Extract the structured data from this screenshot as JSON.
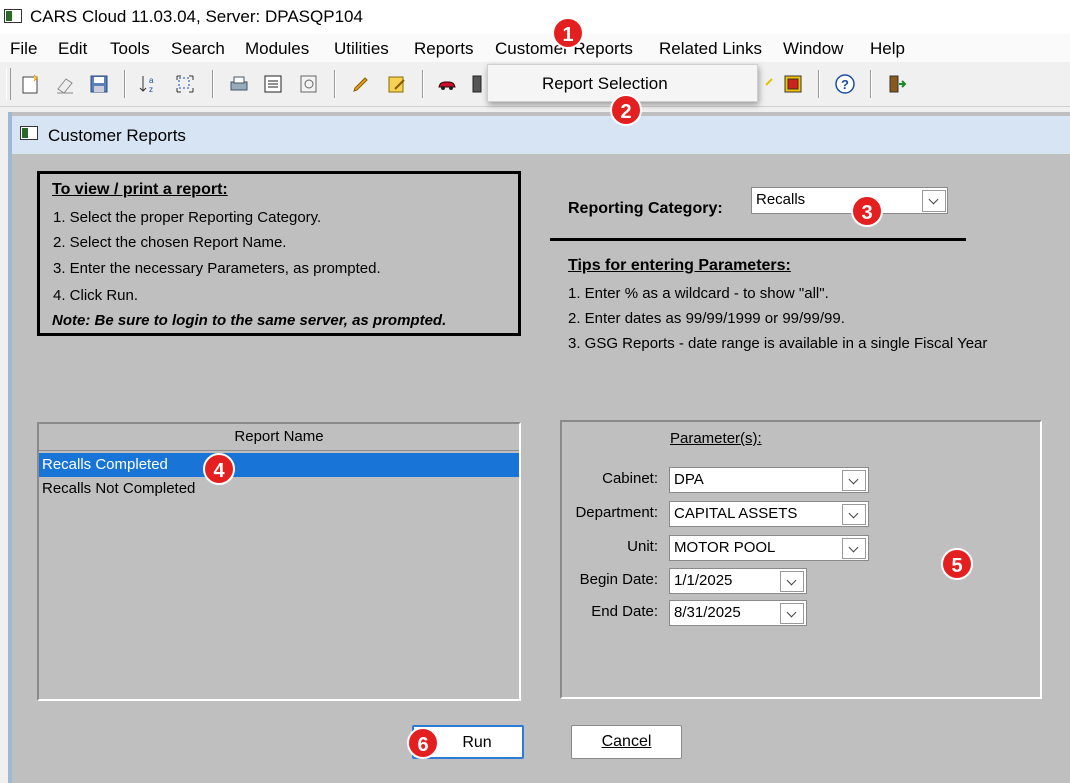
{
  "app": {
    "title": "CARS Cloud 11.03.04, Server: DPASQP104"
  },
  "menu": [
    "File",
    "Edit",
    "Tools",
    "Search",
    "Modules",
    "Utilities",
    "Reports",
    "Customer Reports",
    "Related Links",
    "Window",
    "Help"
  ],
  "toolbar_icons": [
    "new-icon",
    "eraser-icon",
    "save-icon",
    "sort-az-icon",
    "zoom-fit-icon",
    "print-icon",
    "report-icon",
    "preview-icon",
    "pen-icon",
    "edit-icon",
    "car-icon",
    "gas-pump-icon",
    "star-icon",
    "cabinet-icon",
    "help-icon",
    "exit-icon"
  ],
  "dropdown": {
    "item": "Report Selection"
  },
  "callouts": [
    "1",
    "2",
    "3",
    "4",
    "5",
    "6"
  ],
  "window": {
    "title": "Customer Reports"
  },
  "instructions": {
    "heading": "To view / print a report:",
    "steps": [
      "1.  Select the proper Reporting Category.",
      "2.  Select the chosen Report Name.",
      "3.  Enter the necessary Parameters, as prompted.",
      "4.  Click Run."
    ],
    "note": "Note:  Be sure to login to the same server, as prompted."
  },
  "reporting_category": {
    "label": "Reporting Category:",
    "value": "Recalls"
  },
  "tips": {
    "heading": "Tips for entering Parameters:",
    "items": [
      "1.  Enter % as a wildcard - to show \"all\".",
      "2.  Enter dates as  99/99/1999  or  99/99/99.",
      "3.  GSG Reports - date range is available in a single Fiscal Year"
    ]
  },
  "report_list": {
    "header": "Report Name",
    "rows": [
      "Recalls Completed",
      "Recalls Not Completed"
    ],
    "selected_index": 0
  },
  "parameters": {
    "heading": "Parameter(s):",
    "fields": [
      {
        "label": "Cabinet:",
        "value": "DPA"
      },
      {
        "label": "Department:",
        "value": "CAPITAL ASSETS"
      },
      {
        "label": "Unit:",
        "value": "MOTOR POOL"
      },
      {
        "label": "Begin Date:",
        "value": "1/1/2025"
      },
      {
        "label": "End Date:",
        "value": "8/31/2025"
      }
    ]
  },
  "buttons": {
    "run": "Run",
    "cancel": "Cancel"
  },
  "colors": {
    "callout": "#e31f1f",
    "selection": "#1874d6",
    "window_bg": "#bfbfbf"
  }
}
